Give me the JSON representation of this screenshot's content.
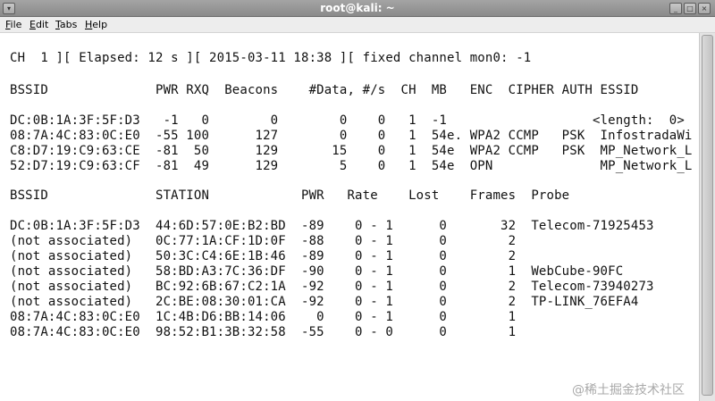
{
  "window": {
    "title": "root@kali: ~"
  },
  "menu": {
    "file": "File",
    "edit": "Edit",
    "tabs": "Tabs",
    "help": "Help"
  },
  "header_line": "CH  1 ][ Elapsed: 12 s ][ 2015-03-11 18:38 ][ fixed channel mon0: -1",
  "ap_table": {
    "header": "BSSID              PWR RXQ  Beacons    #Data, #/s  CH  MB   ENC  CIPHER AUTH ESSID",
    "rows": [
      "DC:0B:1A:3F:5F:D3   -1   0        0        0    0   1  -1                   <length:  0>",
      "08:7A:4C:83:0C:E0  -55 100      127        0    0   1  54e. WPA2 CCMP   PSK  InfostradaWi",
      "C8:D7:19:C9:63:CE  -81  50      129       15    0   1  54e  WPA2 CCMP   PSK  MP_Network_L",
      "52:D7:19:C9:63:CF  -81  49      129        5    0   1  54e  OPN              MP_Network_L"
    ]
  },
  "station_table": {
    "header": "BSSID              STATION            PWR   Rate    Lost    Frames  Probe",
    "rows": [
      "DC:0B:1A:3F:5F:D3  44:6D:57:0E:B2:BD  -89    0 - 1      0       32  Telecom-71925453",
      "(not associated)   0C:77:1A:CF:1D:0F  -88    0 - 1      0        2",
      "(not associated)   50:3C:C4:6E:1B:46  -89    0 - 1      0        2",
      "(not associated)   58:BD:A3:7C:36:DF  -90    0 - 1      0        1  WebCube-90FC",
      "(not associated)   BC:92:6B:67:C2:1A  -92    0 - 1      0        2  Telecom-73940273",
      "(not associated)   2C:BE:08:30:01:CA  -92    0 - 1      0        2  TP-LINK_76EFA4",
      "08:7A:4C:83:0C:E0  1C:4B:D6:BB:14:06    0    0 - 1      0        1",
      "08:7A:4C:83:0C:E0  98:52:B1:3B:32:58  -55    0 - 0      0        1"
    ]
  },
  "watermark": "@稀土掘金技术社区"
}
